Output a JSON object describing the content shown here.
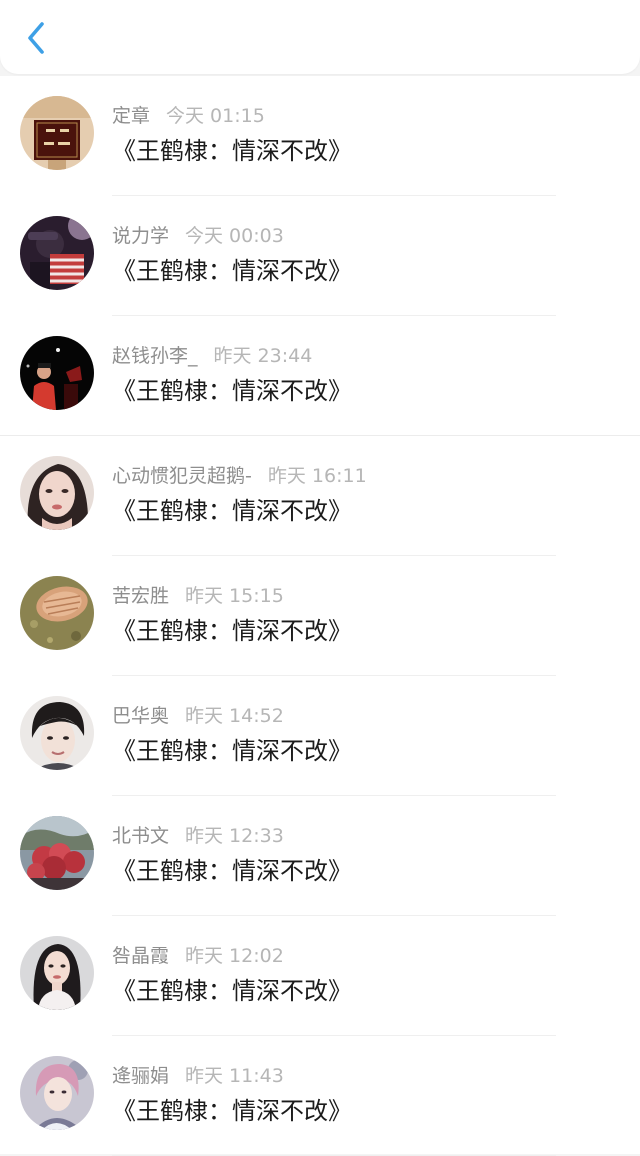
{
  "header": {
    "back_icon": "chevron-left-icon",
    "accent_color": "#3ea0e6"
  },
  "messages": [
    {
      "user": "定章",
      "time": "今天 01:15",
      "text": "《王鹤棣：情深不改》",
      "avatar": "sign-avatar"
    },
    {
      "user": "说力学",
      "time": "今天 00:03",
      "text": "《王鹤棣：情深不改》",
      "avatar": "person-avatar"
    },
    {
      "user": "赵钱孙李_",
      "time": "昨天 23:44",
      "text": "《王鹤棣：情深不改》",
      "avatar": "concert-avatar"
    },
    {
      "user": "心动惯犯灵超鹅-",
      "time": "昨天 16:11",
      "text": "《王鹤棣：情深不改》",
      "avatar": "portrait-avatar"
    },
    {
      "user": "苦宏胜",
      "time": "昨天 15:15",
      "text": "《王鹤棣：情深不改》",
      "avatar": "shell-avatar"
    },
    {
      "user": "巴华奥",
      "time": "昨天 14:52",
      "text": "《王鹤棣：情深不改》",
      "avatar": "portrait-avatar"
    },
    {
      "user": "北书文",
      "time": "昨天 12:33",
      "text": "《王鹤棣：情深不改》",
      "avatar": "flower-avatar"
    },
    {
      "user": "咎晶霞",
      "time": "昨天 12:02",
      "text": "《王鹤棣：情深不改》",
      "avatar": "portrait-avatar"
    },
    {
      "user": "逄骊娟",
      "time": "昨天 11:43",
      "text": "《王鹤棣：情深不改》",
      "avatar": "illustration-avatar"
    }
  ]
}
